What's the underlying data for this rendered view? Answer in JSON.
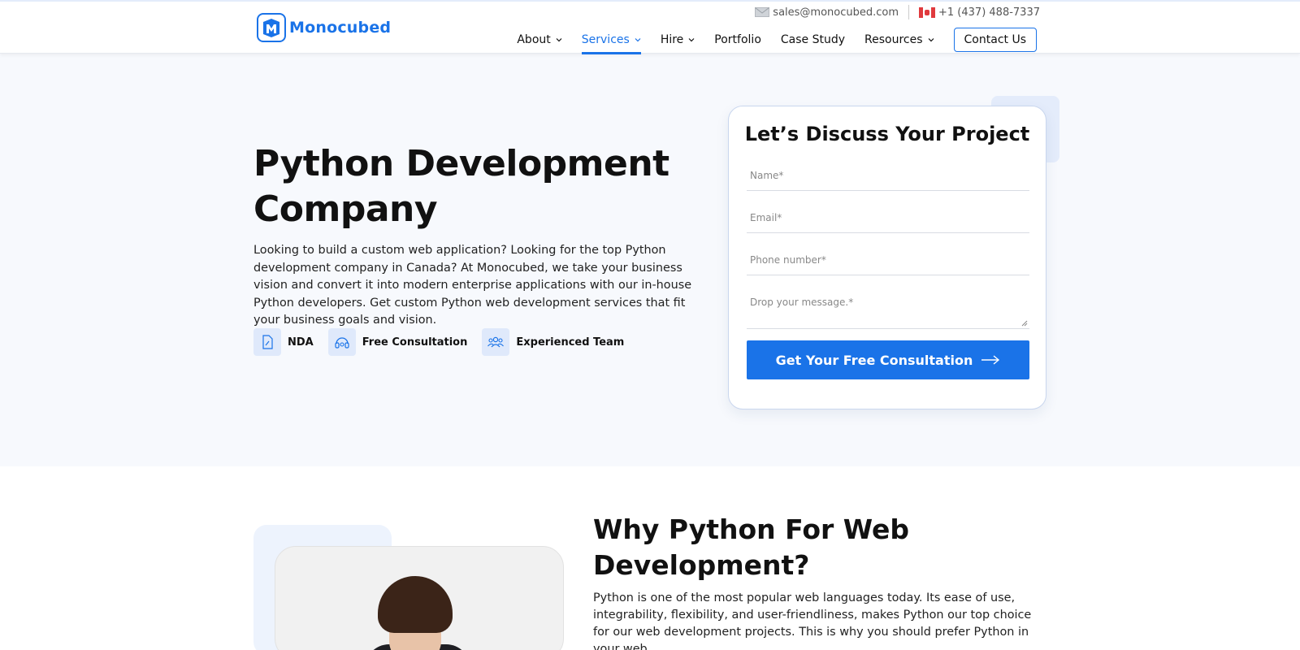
{
  "header": {
    "logo_text": "Monocubed",
    "email": "sales@monocubed.com",
    "phone": "+1 (437) 488-7337",
    "nav": [
      {
        "label": "About",
        "dropdown": true
      },
      {
        "label": "Services",
        "dropdown": true,
        "active": true
      },
      {
        "label": "Hire",
        "dropdown": true
      },
      {
        "label": "Portfolio",
        "dropdown": false
      },
      {
        "label": "Case Study",
        "dropdown": false
      },
      {
        "label": "Resources",
        "dropdown": true
      }
    ],
    "contact_label": "Contact Us"
  },
  "hero": {
    "title": "Python Development Company",
    "description": "Looking to build a custom web application? Looking for the top Python development company in Canada? At Monocubed, we take your business vision and convert it into modern enterprise applications with our in-house Python developers. Get custom Python web development services that fit your business goals and vision.",
    "features": [
      {
        "icon": "document-icon",
        "label": "NDA"
      },
      {
        "icon": "headset-icon",
        "label": "Free Consultation"
      },
      {
        "icon": "team-icon",
        "label": "Experienced Team"
      }
    ]
  },
  "form": {
    "title": "Let’s Discuss Your Project",
    "name_placeholder": "Name*",
    "email_placeholder": "Email*",
    "phone_placeholder": "Phone number*",
    "message_placeholder": "Drop your message.*",
    "submit_label": "Get Your Free Consultation"
  },
  "why": {
    "title": "Why Python For Web Development?",
    "description": "Python is one of the most popular web languages today. Its ease of use, integrability, flexibility, and user-friendliness, makes Python our top choice for our web development projects. This is why you should prefer Python in your web"
  },
  "colors": {
    "accent": "#1a73e8",
    "hero_bg": "#f7f9fd"
  }
}
